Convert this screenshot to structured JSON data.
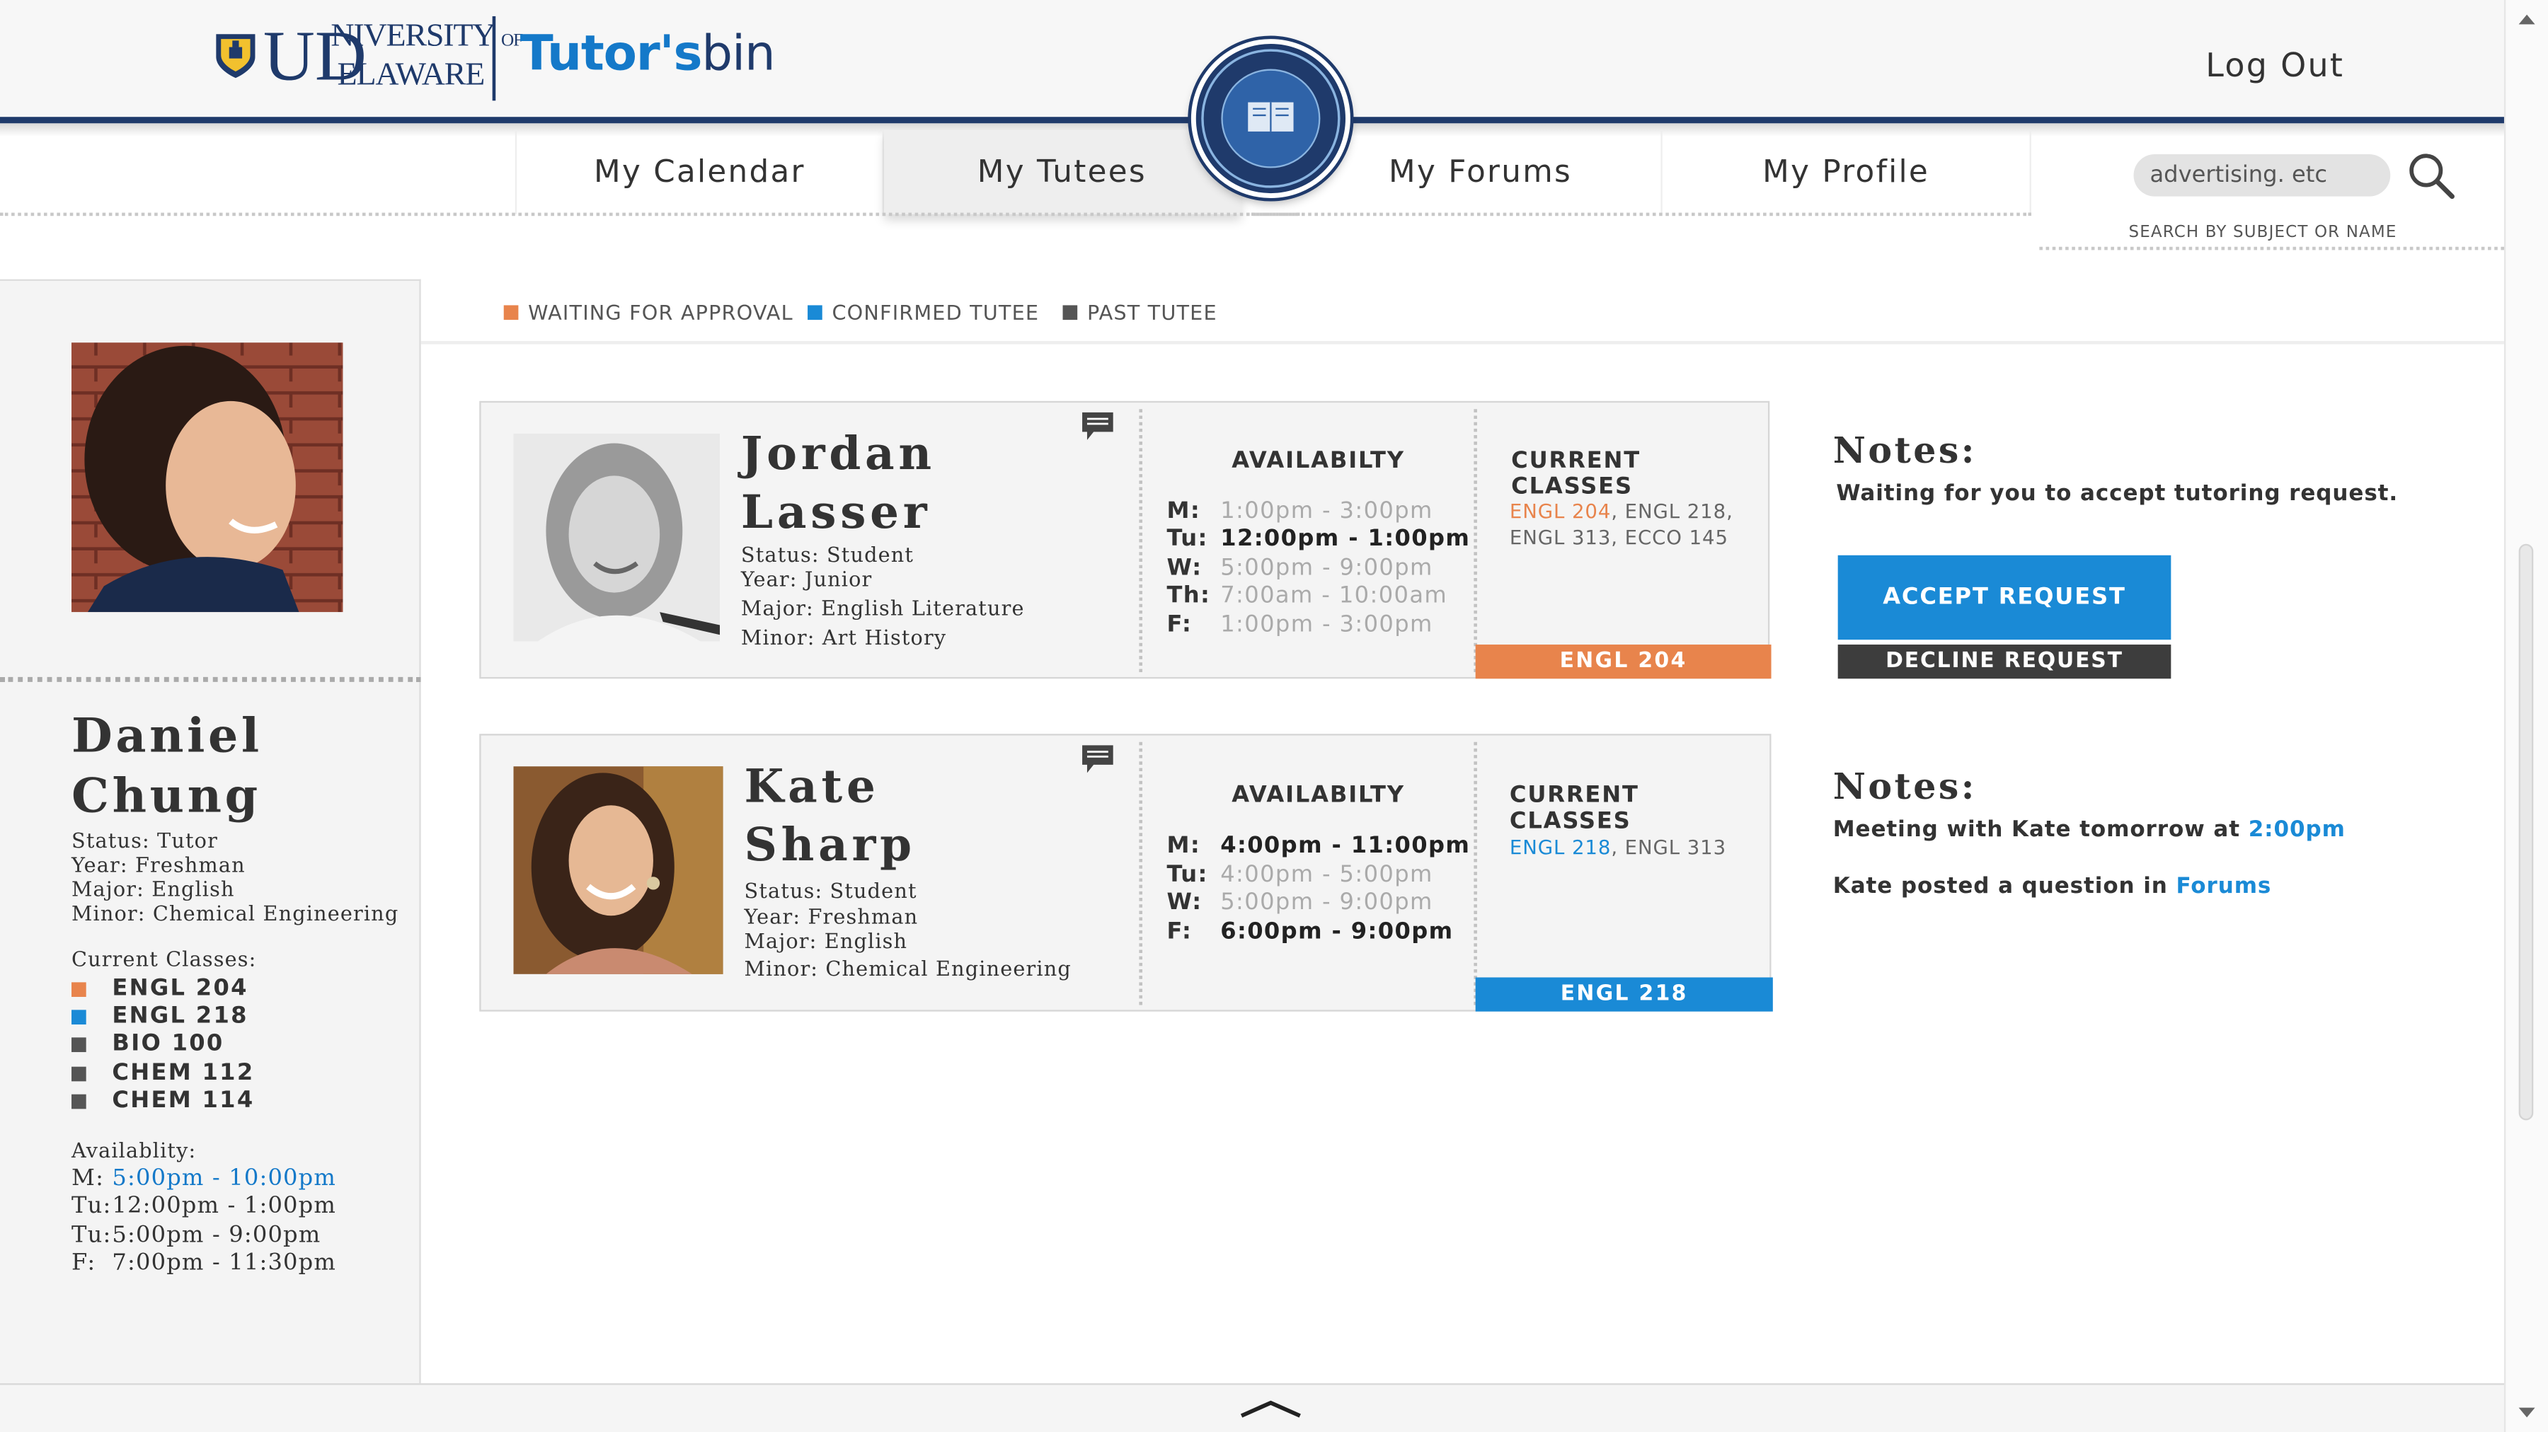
{
  "brand": {
    "university": "UNIVERSITY OF DELAWARE",
    "university_line1": "NIVERSITY",
    "university_of": "OF",
    "university_line2": "ELAWARE",
    "app_name_main": "Tutor's",
    "app_name_suffix": "bin",
    "colors": {
      "navy": "#1f3a6b",
      "blue": "#1a8ad6",
      "orange": "#e8844c",
      "gray": "#555555"
    }
  },
  "header": {
    "logout_label": "Log Out"
  },
  "nav": {
    "items": [
      {
        "label": "My Calendar",
        "active": false
      },
      {
        "label": "My Tutees",
        "active": true
      },
      {
        "label": "My Forums",
        "active": false
      },
      {
        "label": "My Profile",
        "active": false
      }
    ]
  },
  "search": {
    "placeholder": "advertising. etc",
    "hint": "SEARCH BY SUBJECT OR NAME",
    "icon": "search-icon"
  },
  "legend": [
    {
      "label": "WAITING FOR APPROVAL",
      "color": "#e8844c"
    },
    {
      "label": "CONFIRMED TUTEE",
      "color": "#1a8ad6"
    },
    {
      "label": "PAST TUTEE",
      "color": "#555555"
    }
  ],
  "profile": {
    "first_name": "Daniel",
    "last_name": "Chung",
    "status": "Status: Tutor",
    "year": "Year: Freshman",
    "major": "Major: English",
    "minor": "Minor: Chemical Engineering",
    "classes_label": "Current Classes:",
    "classes": [
      {
        "code": "ENGL 204",
        "color": "#e8844c"
      },
      {
        "code": "ENGL 218",
        "color": "#1a8ad6"
      },
      {
        "code": "BIO 100",
        "color": "#555555"
      },
      {
        "code": "CHEM 112",
        "color": "#555555"
      },
      {
        "code": "CHEM 114",
        "color": "#555555"
      }
    ],
    "availability_label": "Availablity:",
    "availability": [
      {
        "day": "M:",
        "time": "5:00pm - 10:00pm",
        "highlight": true
      },
      {
        "day": "Tu:",
        "time": "12:00pm - 1:00pm",
        "highlight": false
      },
      {
        "day": "Tu:",
        "time": "5:00pm - 9:00pm",
        "highlight": false
      },
      {
        "day": "F:",
        "time": "7:00pm - 11:30pm",
        "highlight": false
      }
    ]
  },
  "tutees": [
    {
      "first_name": "Jordan",
      "last_name": "Lasser",
      "status": "Status: Student",
      "year": "Year: Junior",
      "major": "Major: English Literature",
      "minor": "Minor: Art History",
      "availability_title": "AVAILABILTY",
      "classes_title": "CURRENT CLASSES",
      "availability": [
        {
          "day": "M:",
          "time": "1:00pm - 3:00pm",
          "highlight": false
        },
        {
          "day": "Tu:",
          "time": "12:00pm - 1:00pm",
          "highlight": true
        },
        {
          "day": "W:",
          "time": "5:00pm - 9:00pm",
          "highlight": false
        },
        {
          "day": "Th:",
          "time": "7:00am - 10:00am",
          "highlight": false
        },
        {
          "day": "F:",
          "time": "1:00pm - 3:00pm",
          "highlight": false
        }
      ],
      "class_highlight": "ENGL 204",
      "class_rest": ", ENGL 218, ENGL 313, ECCO 145",
      "tag": "ENGL 204",
      "tag_color": "#e8844c",
      "state": "waiting",
      "notes_title": "Notes:",
      "note": "Waiting for you to accept tutoring request.",
      "accept_label": "ACCEPT REQUEST",
      "decline_label": "DECLINE REQUEST"
    },
    {
      "first_name": "Kate",
      "last_name": "Sharp",
      "status": "Status: Student",
      "year": "Year: Freshman",
      "major": "Major: English",
      "minor": "Minor: Chemical Engineering",
      "availability_title": "AVAILABILTY",
      "classes_title": "CURRENT CLASSES",
      "availability": [
        {
          "day": "M:",
          "time": "4:00pm - 11:00pm",
          "highlight": true
        },
        {
          "day": "Tu:",
          "time": "4:00pm - 5:00pm",
          "highlight": false
        },
        {
          "day": "W:",
          "time": "5:00pm - 9:00pm",
          "highlight": false
        },
        {
          "day": "F:",
          "time": "6:00pm - 9:00pm",
          "highlight": true
        }
      ],
      "class_highlight": "ENGL 218",
      "class_rest": ", ENGL 313",
      "tag": "ENGL 218",
      "tag_color": "#1a8ad6",
      "state": "confirmed",
      "notes_title": "Notes:",
      "note_prefix": "Meeting with Kate tomorrow at ",
      "note_time": "2:00pm",
      "note2_prefix": "Kate posted a question in ",
      "note2_link": "Forums"
    }
  ]
}
